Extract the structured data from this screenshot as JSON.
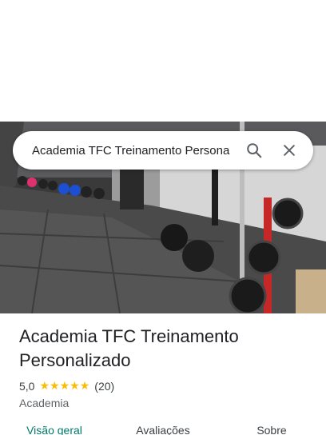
{
  "search": {
    "query": "Academia TFC Treinamento Persona",
    "search_icon": "search-icon",
    "close_icon": "close-icon"
  },
  "place": {
    "title": "Academia TFC Treinamento Personalizado",
    "rating": "5,0",
    "stars": 5,
    "review_count": "(20)",
    "category": "Academia"
  },
  "tabs": [
    {
      "label": "Visão geral",
      "active": true
    },
    {
      "label": "Avaliações",
      "active": false
    },
    {
      "label": "Sobre",
      "active": false
    }
  ],
  "colors": {
    "star": "#fbbc04",
    "active_tab": "#00796b",
    "text_primary": "#202124",
    "text_secondary": "#5f6368"
  }
}
